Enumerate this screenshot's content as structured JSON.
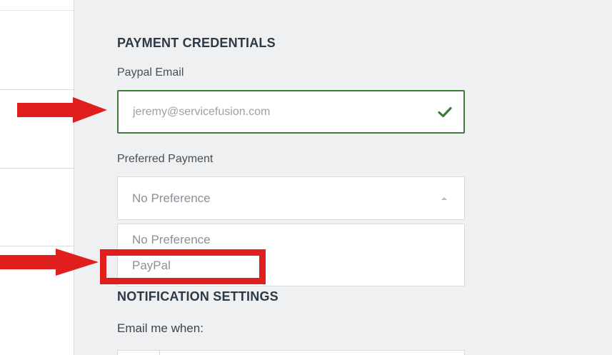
{
  "payment_credentials": {
    "title": "PAYMENT CREDENTIALS",
    "paypal_email_label": "Paypal Email",
    "paypal_email_value": "jeremy@servicefusion.com",
    "preferred_payment_label": "Preferred Payment",
    "preferred_payment_selected": "No Preference",
    "options": [
      "No Preference",
      "PayPal"
    ]
  },
  "notification_settings": {
    "title": "NOTIFICATION SETTINGS",
    "email_me_when_label": "Email me when:"
  },
  "colors": {
    "valid_border": "#3c7a3c",
    "annotation_red": "#e01e1e",
    "panel_bg": "#eef0f1"
  },
  "icons": {
    "valid": "check-icon",
    "dropdown_open": "caret-up-icon"
  }
}
